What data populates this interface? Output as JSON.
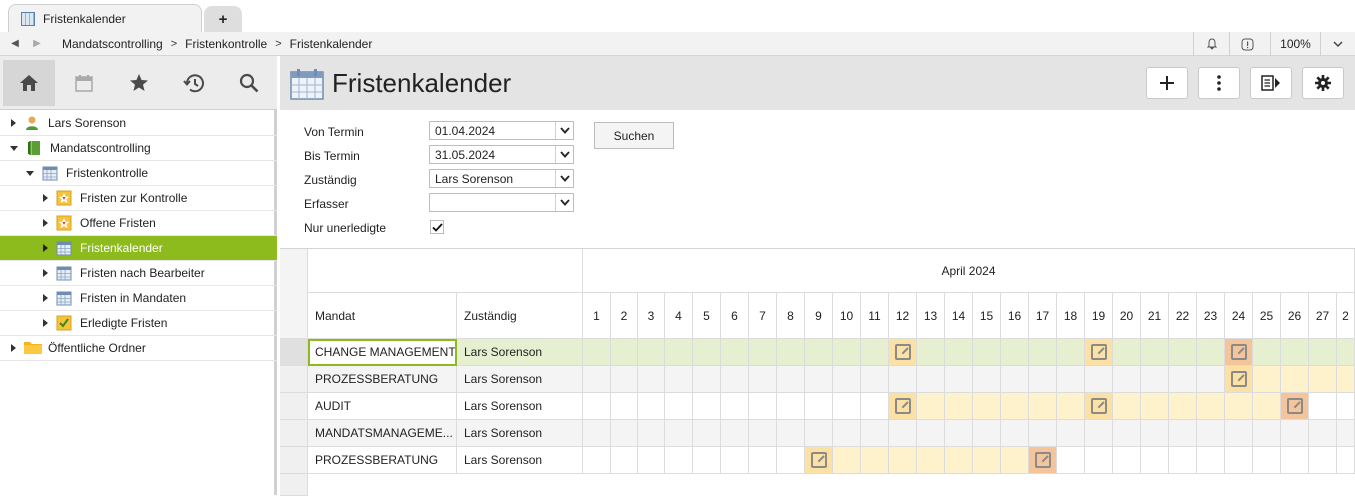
{
  "tab": {
    "title": "Fristenkalender",
    "new_tab": "+"
  },
  "breadcrumb": {
    "items": [
      "Mandatscontrolling",
      "Fristenkontrolle",
      "Fristenkalender"
    ],
    "separator": ">"
  },
  "nav_right": {
    "zoom": "100%"
  },
  "sidebar": {
    "icons": [
      "home-icon",
      "calendar-icon",
      "star-icon",
      "history-icon",
      "search-icon"
    ],
    "items": [
      {
        "label": "Lars Sorenson",
        "icon": "user-icon",
        "state": "collapsed"
      },
      {
        "label": "Mandatscontrolling",
        "icon": "book-icon",
        "state": "expanded"
      },
      {
        "label": "Fristenkontrolle",
        "icon": "calendar-icon",
        "state": "expanded"
      },
      {
        "label": "Fristen zur Kontrolle",
        "icon": "deadline-star-icon",
        "state": "collapsed"
      },
      {
        "label": "Offene Fristen",
        "icon": "deadline-star-icon",
        "state": "collapsed"
      },
      {
        "label": "Fristenkalender",
        "icon": "calendar-icon",
        "state": "collapsed",
        "selected": true
      },
      {
        "label": "Fristen nach Bearbeiter",
        "icon": "calendar-icon",
        "state": "collapsed"
      },
      {
        "label": "Fristen in Mandaten",
        "icon": "calendar-icon",
        "state": "collapsed"
      },
      {
        "label": "Erledigte Fristen",
        "icon": "check-calendar-icon",
        "state": "collapsed"
      },
      {
        "label": "Öffentliche Ordner",
        "icon": "folder-icon",
        "state": "collapsed"
      }
    ]
  },
  "page": {
    "title": "Fristenkalender",
    "title_icon": "calendar-icon"
  },
  "toolbar": {
    "buttons": [
      "plus-icon",
      "more-vertical-icon",
      "export-icon",
      "settings-icon"
    ]
  },
  "filters": {
    "von_label": "Von Termin",
    "von_value": "01.04.2024",
    "bis_label": "Bis Termin",
    "bis_value": "31.05.2024",
    "zust_label": "Zuständig",
    "zust_value": "Lars Sorenson",
    "erf_label": "Erfasser",
    "erf_value": "",
    "nur_label": "Nur unerledigte",
    "nur_checked": true,
    "search_button": "Suchen"
  },
  "calendar": {
    "month": "April 2024",
    "col_mandat": "Mandat",
    "col_zust": "Zuständig",
    "days": [
      "1",
      "2",
      "3",
      "4",
      "5",
      "6",
      "7",
      "8",
      "9",
      "10",
      "11",
      "12",
      "13",
      "14",
      "15",
      "16",
      "17",
      "18",
      "19",
      "20",
      "21",
      "22",
      "23",
      "24",
      "25",
      "26",
      "27",
      "2"
    ],
    "rows": [
      {
        "mandat": "CHANGE MANAGEMENT",
        "zust": "Lars Sorenson",
        "selected": true,
        "highlight": [],
        "events": {
          "12": "yellow",
          "19": "yellow",
          "24": "orange"
        }
      },
      {
        "mandat": "PROZESSBERATUNG",
        "zust": "Lars Sorenson",
        "highlight": [
          24,
          28
        ],
        "events": {
          "24": "yellow"
        }
      },
      {
        "mandat": "AUDIT",
        "zust": "Lars Sorenson",
        "highlight": [
          12,
          26
        ],
        "events": {
          "12": "yellow",
          "19": "yellow",
          "26": "orange"
        }
      },
      {
        "mandat": "MANDATSMANAGEME...",
        "zust": "Lars Sorenson",
        "highlight": [],
        "events": {}
      },
      {
        "mandat": "PROZESSBERATUNG",
        "zust": "Lars Sorenson",
        "highlight": [
          9,
          17
        ],
        "events": {
          "9": "yellow",
          "17": "orange"
        }
      }
    ]
  }
}
